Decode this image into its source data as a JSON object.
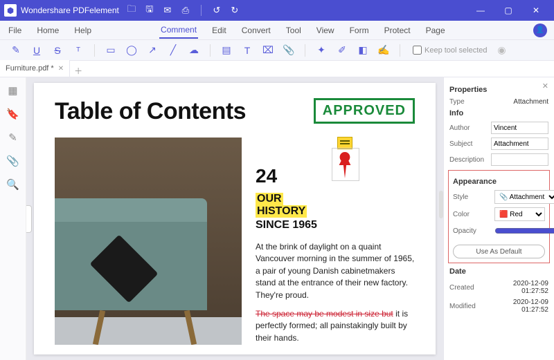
{
  "titlebar": {
    "app_name": "Wondershare PDFelement"
  },
  "menu": {
    "items": [
      "File",
      "Home",
      "Help",
      "Comment",
      "Edit",
      "Convert",
      "Tool",
      "View",
      "Form",
      "Protect",
      "Page"
    ],
    "active": "Comment"
  },
  "toolbar": {
    "keep_tool_label": "Keep tool selected"
  },
  "tabs": {
    "items": [
      {
        "label": "Furniture.pdf *"
      }
    ]
  },
  "document": {
    "title": "Table of Contents",
    "stamp": "APPROVED",
    "number": "24",
    "highlight1": "OUR",
    "highlight2": "HISTORY",
    "since": "SINCE 1965",
    "para1": "At the brink of daylight on a quaint Vancouver morning in the summer of 1965, a pair of young Danish cabinetmakers stand at the entrance of their new factory. They're proud.",
    "para2_strike": "The space may be modest in size but",
    "para2_rest": " it is perfectly formed; all painstakingly built by their hands."
  },
  "properties": {
    "panel_title": "Properties",
    "type_label": "Type",
    "type_value": "Attachment",
    "info_title": "Info",
    "author_label": "Author",
    "author_value": "Vincent",
    "subject_label": "Subject",
    "subject_value": "Attachment",
    "description_label": "Description",
    "description_value": "",
    "appearance_title": "Appearance",
    "style_label": "Style",
    "style_value": "Attachment",
    "color_label": "Color",
    "color_value": "Red",
    "opacity_label": "Opacity",
    "opacity_value": "100",
    "opacity_unit": "%",
    "default_btn": "Use As Default",
    "date_title": "Date",
    "created_label": "Created",
    "created_value": "2020-12-09 01:27:52",
    "modified_label": "Modified",
    "modified_value": "2020-12-09 01:27:52"
  }
}
